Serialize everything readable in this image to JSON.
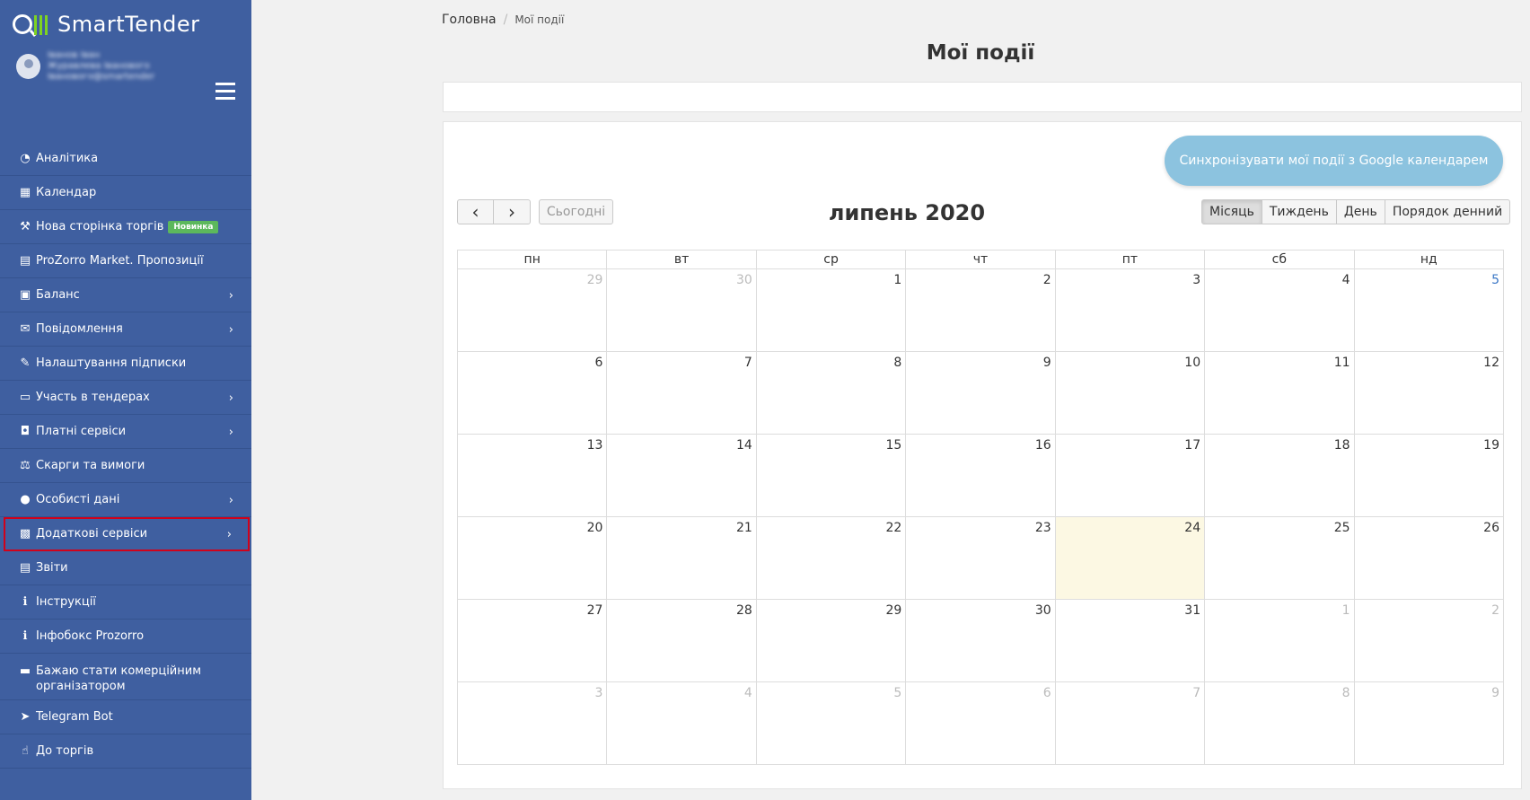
{
  "brand": {
    "logo_text": "SmartTender"
  },
  "user": {
    "name": "Іванов Іван",
    "email": "Журавлева Іванового Іванового@smartender"
  },
  "sidebar": {
    "items": [
      {
        "icon": "pie-chart-icon",
        "glyph": "◔",
        "label": "Аналітика",
        "chevron": false
      },
      {
        "icon": "calendar-icon",
        "glyph": "▦",
        "label": "Календар",
        "chevron": false
      },
      {
        "icon": "gavel-icon",
        "glyph": "⚒",
        "label": "Нова сторінка торгів",
        "badge": "Новинка",
        "chevron": false
      },
      {
        "icon": "document-icon",
        "glyph": "▤",
        "label": "ProZorro Market. Пропозиції",
        "chevron": false
      },
      {
        "icon": "money-icon",
        "glyph": "▣",
        "label": "Баланс",
        "chevron": true
      },
      {
        "icon": "envelope-icon",
        "glyph": "✉",
        "label": "Повідомлення",
        "chevron": true
      },
      {
        "icon": "wrench-icon",
        "glyph": "✎",
        "label": "Налаштування підписки",
        "chevron": false
      },
      {
        "icon": "folder-icon",
        "glyph": "▭",
        "label": "Участь в тендерах",
        "chevron": true
      },
      {
        "icon": "shopping-bag-icon",
        "glyph": "◘",
        "label": "Платні сервіси",
        "chevron": true
      },
      {
        "icon": "balance-scale-icon",
        "glyph": "⚖",
        "label": "Скарги та вимоги",
        "chevron": false
      },
      {
        "icon": "user-icon",
        "glyph": "●",
        "label": "Особисті дані",
        "chevron": true
      },
      {
        "icon": "services-icon",
        "glyph": "▩",
        "label": "Додаткові сервіси",
        "chevron": true,
        "highlight": true
      },
      {
        "icon": "report-icon",
        "glyph": "▤",
        "label": "Звіти",
        "chevron": false
      },
      {
        "icon": "info-icon",
        "glyph": "ℹ",
        "label": "Інструкції",
        "chevron": false
      },
      {
        "icon": "info-icon",
        "glyph": "ℹ",
        "label": "Інфобокс Prozorro",
        "chevron": false
      },
      {
        "icon": "briefcase-icon",
        "glyph": "▬",
        "label": "Бажаю стати комерційним організатором",
        "chevron": false,
        "tall": true
      },
      {
        "icon": "telegram-icon",
        "glyph": "➤",
        "label": "Telegram Bot",
        "chevron": false
      },
      {
        "icon": "thumbs-up-icon",
        "glyph": "☝",
        "label": "До торгів",
        "chevron": false
      }
    ]
  },
  "breadcrumb": {
    "home": "Головна",
    "separator": "/",
    "current": "Мої події"
  },
  "page": {
    "title": "Мої події"
  },
  "calendar": {
    "sync_button": "Синхронізувати мої події з Google календарем",
    "today_button": "Сьогодні",
    "prev_icon": "‹",
    "next_icon": "›",
    "title": "липень 2020",
    "views": [
      "Місяць",
      "Тиждень",
      "День",
      "Порядок денний"
    ],
    "weekdays": [
      "пн",
      "вт",
      "ср",
      "чт",
      "пт",
      "сб",
      "нд"
    ],
    "weeks": [
      [
        {
          "d": "29",
          "o": true
        },
        {
          "d": "30",
          "o": true
        },
        {
          "d": "1"
        },
        {
          "d": "2"
        },
        {
          "d": "3"
        },
        {
          "d": "4"
        },
        {
          "d": "5",
          "blue": true
        }
      ],
      [
        {
          "d": "6"
        },
        {
          "d": "7"
        },
        {
          "d": "8"
        },
        {
          "d": "9"
        },
        {
          "d": "10"
        },
        {
          "d": "11"
        },
        {
          "d": "12"
        }
      ],
      [
        {
          "d": "13"
        },
        {
          "d": "14"
        },
        {
          "d": "15"
        },
        {
          "d": "16"
        },
        {
          "d": "17"
        },
        {
          "d": "18"
        },
        {
          "d": "19"
        }
      ],
      [
        {
          "d": "20"
        },
        {
          "d": "21"
        },
        {
          "d": "22"
        },
        {
          "d": "23"
        },
        {
          "d": "24",
          "today": true
        },
        {
          "d": "25"
        },
        {
          "d": "26"
        }
      ],
      [
        {
          "d": "27"
        },
        {
          "d": "28"
        },
        {
          "d": "29"
        },
        {
          "d": "30"
        },
        {
          "d": "31"
        },
        {
          "d": "1",
          "o": true
        },
        {
          "d": "2",
          "o": true
        }
      ],
      [
        {
          "d": "3",
          "o": true
        },
        {
          "d": "4",
          "o": true
        },
        {
          "d": "5",
          "o": true
        },
        {
          "d": "6",
          "o": true
        },
        {
          "d": "7",
          "o": true
        },
        {
          "d": "8",
          "o": true
        },
        {
          "d": "9",
          "o": true
        }
      ]
    ]
  },
  "colors": {
    "sidebar_bg": "#3f5fa0",
    "badge_green": "#5cb85c",
    "today_bg": "#fcf8e3",
    "sync_btn": "#8cc3df",
    "highlight_border": "#d0021b"
  }
}
